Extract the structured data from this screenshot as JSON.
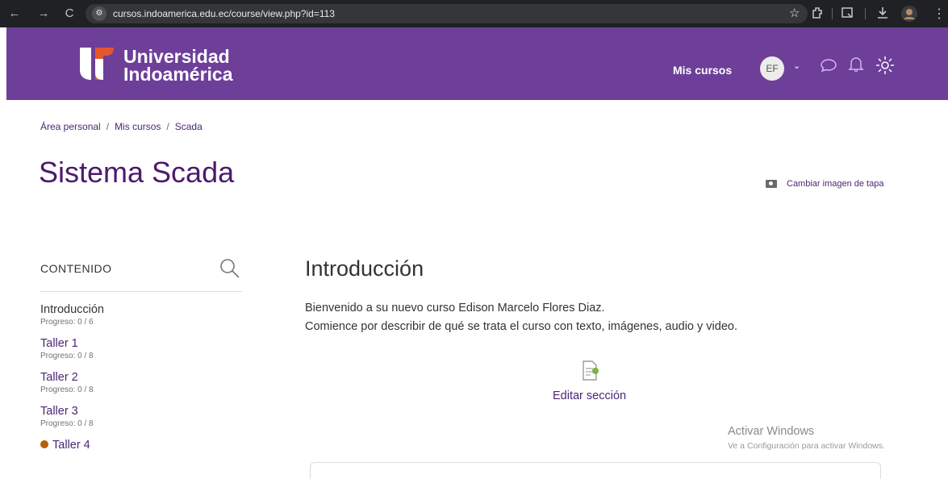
{
  "browser": {
    "url": "cursos.indoamerica.edu.ec/course/view.php?id=113",
    "back": "←",
    "forward": "→",
    "reload": "C",
    "site_info_icon": "⚙"
  },
  "header": {
    "logo_line1": "Universidad",
    "logo_line2": "Indoamérica",
    "nav_my_courses": "Mis cursos",
    "avatar_initials": "EF",
    "brand_color": "#6d3f99"
  },
  "breadcrumb": [
    "Área personal",
    "Mis cursos",
    "Scada"
  ],
  "course": {
    "title": "Sistema Scada",
    "change_cover": "Cambiar imagen de tapa"
  },
  "sidebar": {
    "title": "CONTENIDO",
    "sections": [
      {
        "name": "Introducción",
        "progress": "Progreso: 0 / 6"
      },
      {
        "name": "Taller 1",
        "progress": "Progreso: 0 / 8"
      },
      {
        "name": "Taller 2",
        "progress": "Progreso: 0 / 8"
      },
      {
        "name": "Taller 3",
        "progress": "Progreso: 0 / 8"
      },
      {
        "name": "Taller 4"
      }
    ]
  },
  "main": {
    "section_title": "Introducción",
    "line1": "Bienvenido a su nuevo curso Edison Marcelo Flores Diaz.",
    "line2": "Comience por describir de qué se trata el curso con texto, imágenes, audio y video.",
    "edit_section": "Editar sección"
  },
  "watermark": {
    "title": "Activar Windows",
    "subtitle": "Ve a Configuración para activar Windows."
  }
}
